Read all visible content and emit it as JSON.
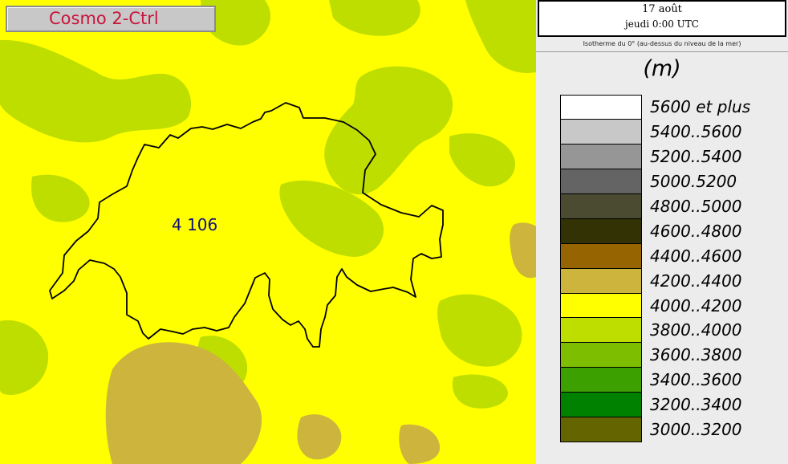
{
  "map": {
    "model_label": "Cosmo 2-Ctrl",
    "value_label": "4 106",
    "colors": {
      "background": "#ffff00",
      "green_areas": "#bede00",
      "ochre_areas": "#cdb43c",
      "border": "#000000"
    }
  },
  "header": {
    "date": "17 août",
    "time": "jeudi 0:00 UTC"
  },
  "legend": {
    "title": "Isotherme du 0° (au-dessus du niveau de la mer)",
    "unit": "(m)",
    "items": [
      {
        "label": "5600 et plus",
        "color": "#ffffff"
      },
      {
        "label": "5400..5600",
        "color": "#c8c8c8"
      },
      {
        "label": "5200..5400",
        "color": "#969696"
      },
      {
        "label": "5000.5200",
        "color": "#646464"
      },
      {
        "label": "4800..5000",
        "color": "#4b4b32"
      },
      {
        "label": "4600..4800",
        "color": "#323205"
      },
      {
        "label": "4400..4600",
        "color": "#966400"
      },
      {
        "label": "4200..4400",
        "color": "#cdb43c"
      },
      {
        "label": "4000..4200",
        "color": "#ffff00"
      },
      {
        "label": "3800..4000",
        "color": "#bede00"
      },
      {
        "label": "3600..3800",
        "color": "#7dbe00"
      },
      {
        "label": "3400..3600",
        "color": "#3ca000"
      },
      {
        "label": "3200..3400",
        "color": "#008200"
      },
      {
        "label": "3000..3200",
        "color": "#646400"
      }
    ]
  }
}
